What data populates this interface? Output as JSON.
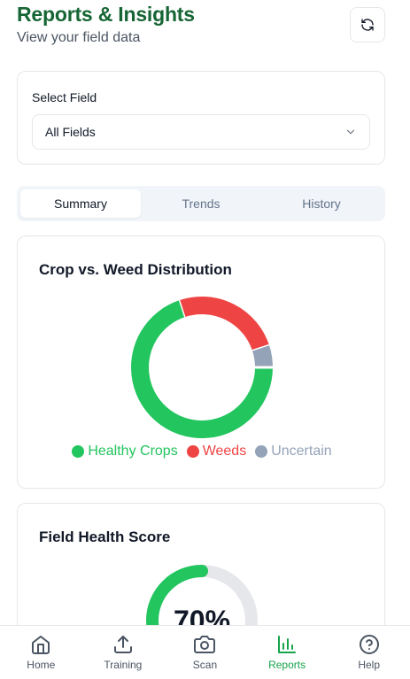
{
  "header": {
    "title": "Reports & Insights",
    "subtitle": "View your field data"
  },
  "select": {
    "label": "Select Field",
    "value": "All Fields"
  },
  "tabs": [
    {
      "label": "Summary",
      "active": true
    },
    {
      "label": "Trends",
      "active": false
    },
    {
      "label": "History",
      "active": false
    }
  ],
  "distribution_card": {
    "title": "Crop vs. Weed Distribution"
  },
  "health_card": {
    "title": "Field Health Score",
    "score_label": "70%"
  },
  "chart_data": [
    {
      "type": "pie",
      "donut": true,
      "categories": [
        "Healthy Crops",
        "Weeds",
        "Uncertain"
      ],
      "values": [
        70,
        25,
        5
      ],
      "colors": [
        "#22c55e",
        "#ef4444",
        "#94a3b8"
      ],
      "legend_position": "bottom"
    },
    {
      "type": "gauge",
      "value": 70,
      "max": 100,
      "colors": [
        "#22c55e",
        "#e5e7eb"
      ]
    }
  ],
  "nav": [
    {
      "label": "Home",
      "icon": "home-icon",
      "active": false
    },
    {
      "label": "Training",
      "icon": "upload-icon",
      "active": false
    },
    {
      "label": "Scan",
      "icon": "camera-icon",
      "active": false
    },
    {
      "label": "Reports",
      "icon": "bar-chart-icon",
      "active": true
    },
    {
      "label": "Help",
      "icon": "help-circle-icon",
      "active": false
    }
  ],
  "colors": {
    "brand_green": "#166534",
    "accent_green": "#16a34a"
  }
}
